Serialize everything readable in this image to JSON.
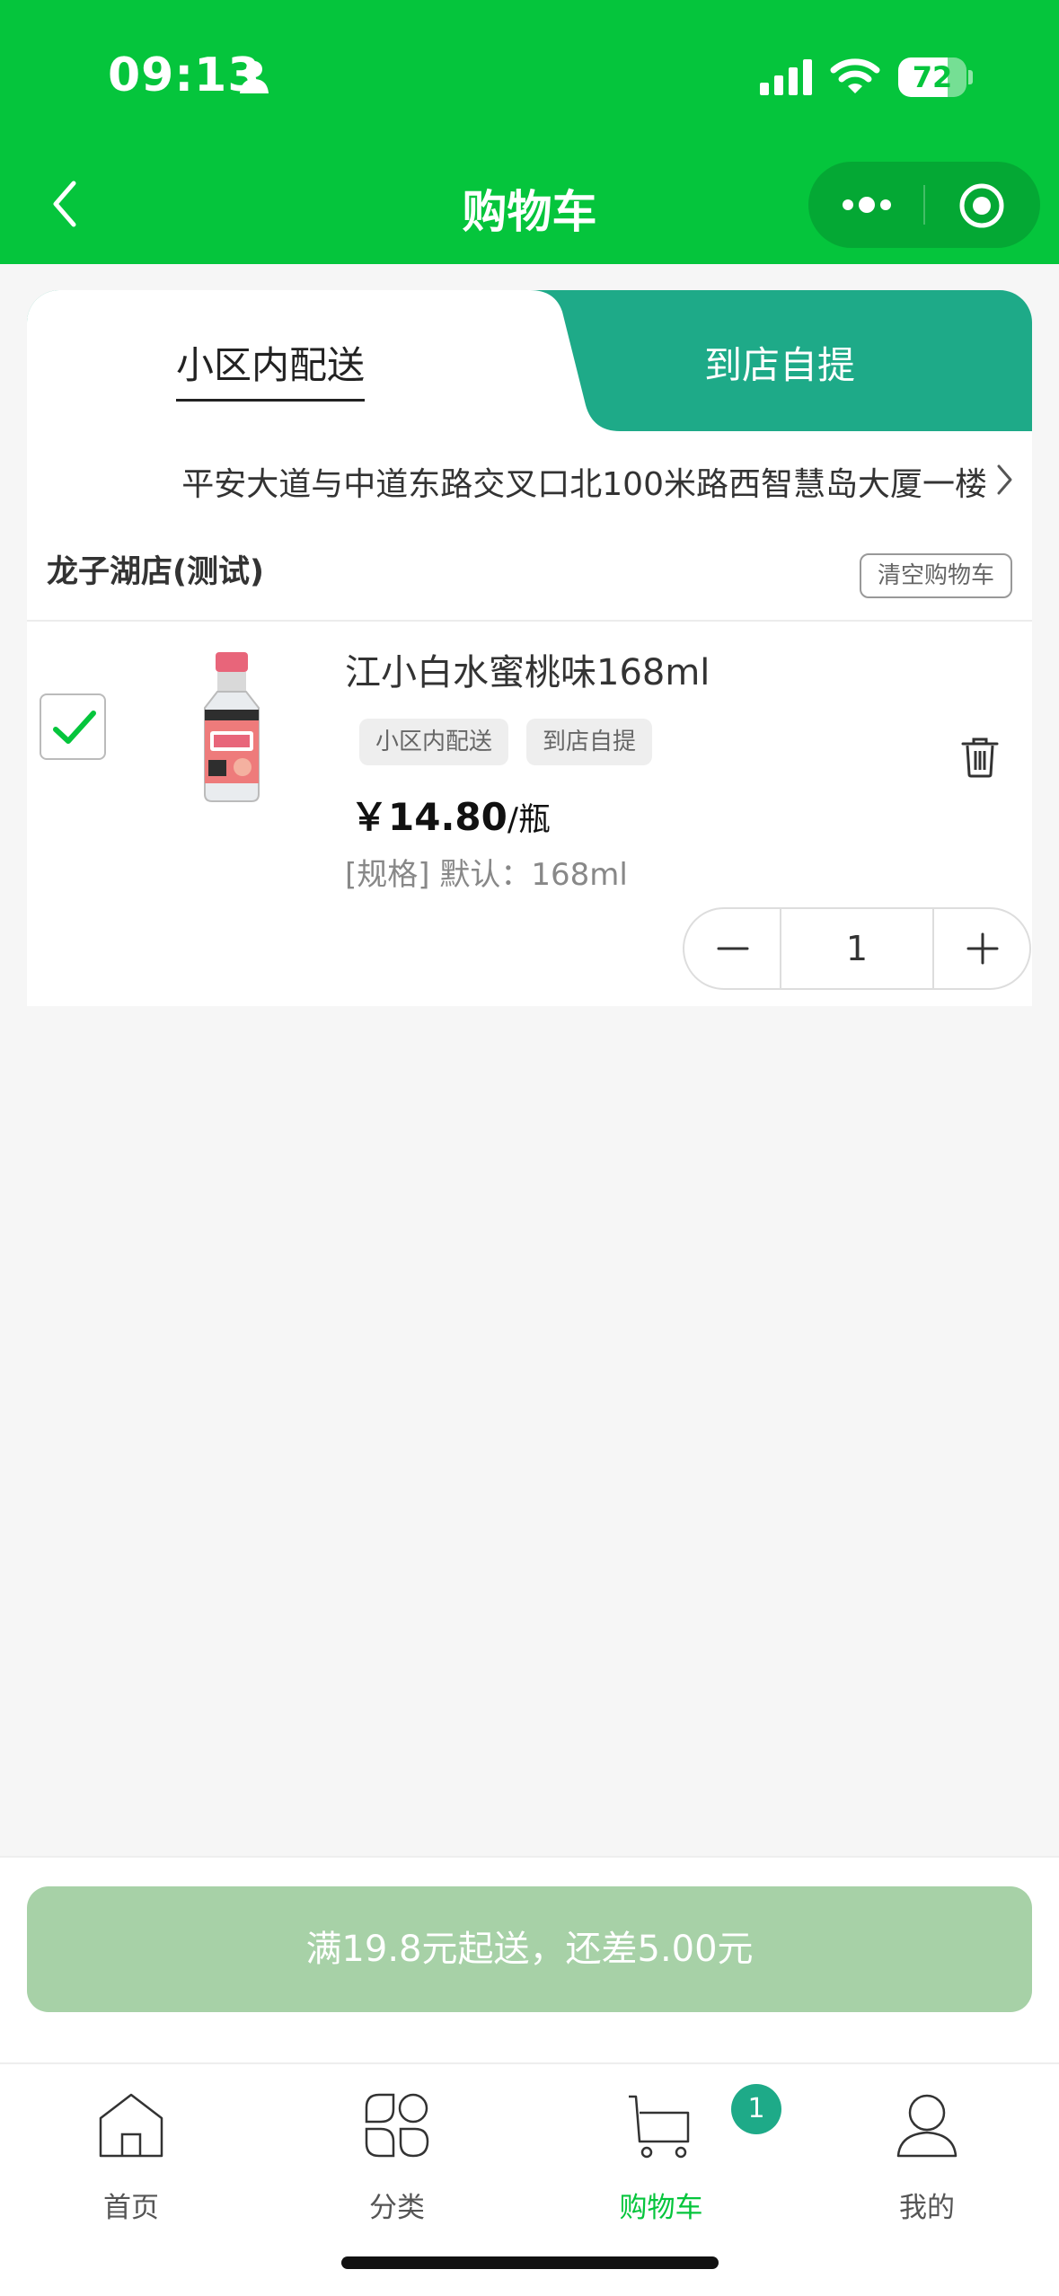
{
  "status_bar": {
    "time": "09:13",
    "battery": "72",
    "battery_level": 0.72,
    "icons": [
      "person-icon",
      "signal-icon",
      "wifi-icon",
      "battery-icon"
    ]
  },
  "nav": {
    "title": "购物车",
    "back_icon": "chevron-left-icon",
    "capsule_icons": [
      "more-icon",
      "target-icon"
    ]
  },
  "colors": {
    "header": "#05c53c",
    "tab_active_bg": "#1eaa88",
    "checkout_disabled": "#a7d1a7",
    "badge": "#1eaa88"
  },
  "delivery_tabs": {
    "delivery": "小区内配送",
    "pickup": "到店自提",
    "selected": "小区内配送"
  },
  "address": {
    "text": "平安大道与中道东路交叉口北100米路西智慧岛大厦一楼"
  },
  "store": {
    "name": "龙子湖店(测试)",
    "clear_label": "清空购物车"
  },
  "cart_items": [
    {
      "checked": true,
      "name": "江小白水蜜桃味168ml",
      "image_icon": "bottle-icon",
      "tags": [
        "小区内配送",
        "到店自提"
      ],
      "price": "￥14.80",
      "unit": "/瓶",
      "spec": "[规格] 默认：168ml",
      "quantity": "1"
    }
  ],
  "checkout": {
    "label": "满19.8元起送，还差5.00元"
  },
  "tabbar": {
    "items": [
      {
        "label": "首页",
        "icon": "home-icon"
      },
      {
        "label": "分类",
        "icon": "category-icon"
      },
      {
        "label": "购物车",
        "icon": "cart-icon",
        "active": true
      },
      {
        "label": "我的",
        "icon": "user-icon"
      }
    ],
    "cart_badge": "1"
  }
}
